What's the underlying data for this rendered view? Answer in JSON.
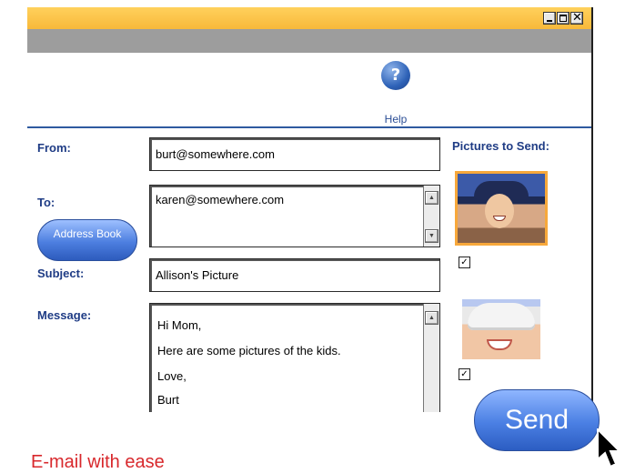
{
  "window": {
    "controls": [
      "minimize",
      "maximize",
      "close"
    ],
    "close_glyph": "✕"
  },
  "toolbar": {
    "help_icon": "help-icon",
    "help_glyph": "?",
    "help_label": "Help"
  },
  "form": {
    "from_label": "From:",
    "from_value": "burt@somewhere.com",
    "to_label": "To:",
    "to_value": "karen@somewhere.com",
    "address_book_label": "Address Book",
    "subject_label": "Subject:",
    "subject_value": "Allison's Picture",
    "message_label": "Message:",
    "message_lines": [
      "Hi Mom,",
      "Here are some pictures of the kids.",
      "Love,",
      "Burt"
    ]
  },
  "pictures": {
    "label": "Pictures to Send:",
    "items": [
      {
        "checked": true
      },
      {
        "checked": true
      }
    ]
  },
  "send_label": "Send",
  "tagline": "E-mail with ease",
  "colors": {
    "titlebar": "#f8b93a",
    "toolbar": "#9d9d9d",
    "label_blue": "#1f3c85",
    "button_blue": "#4a7fe3",
    "tagline_red": "#d8282c",
    "selected_border": "#f7a83b"
  }
}
